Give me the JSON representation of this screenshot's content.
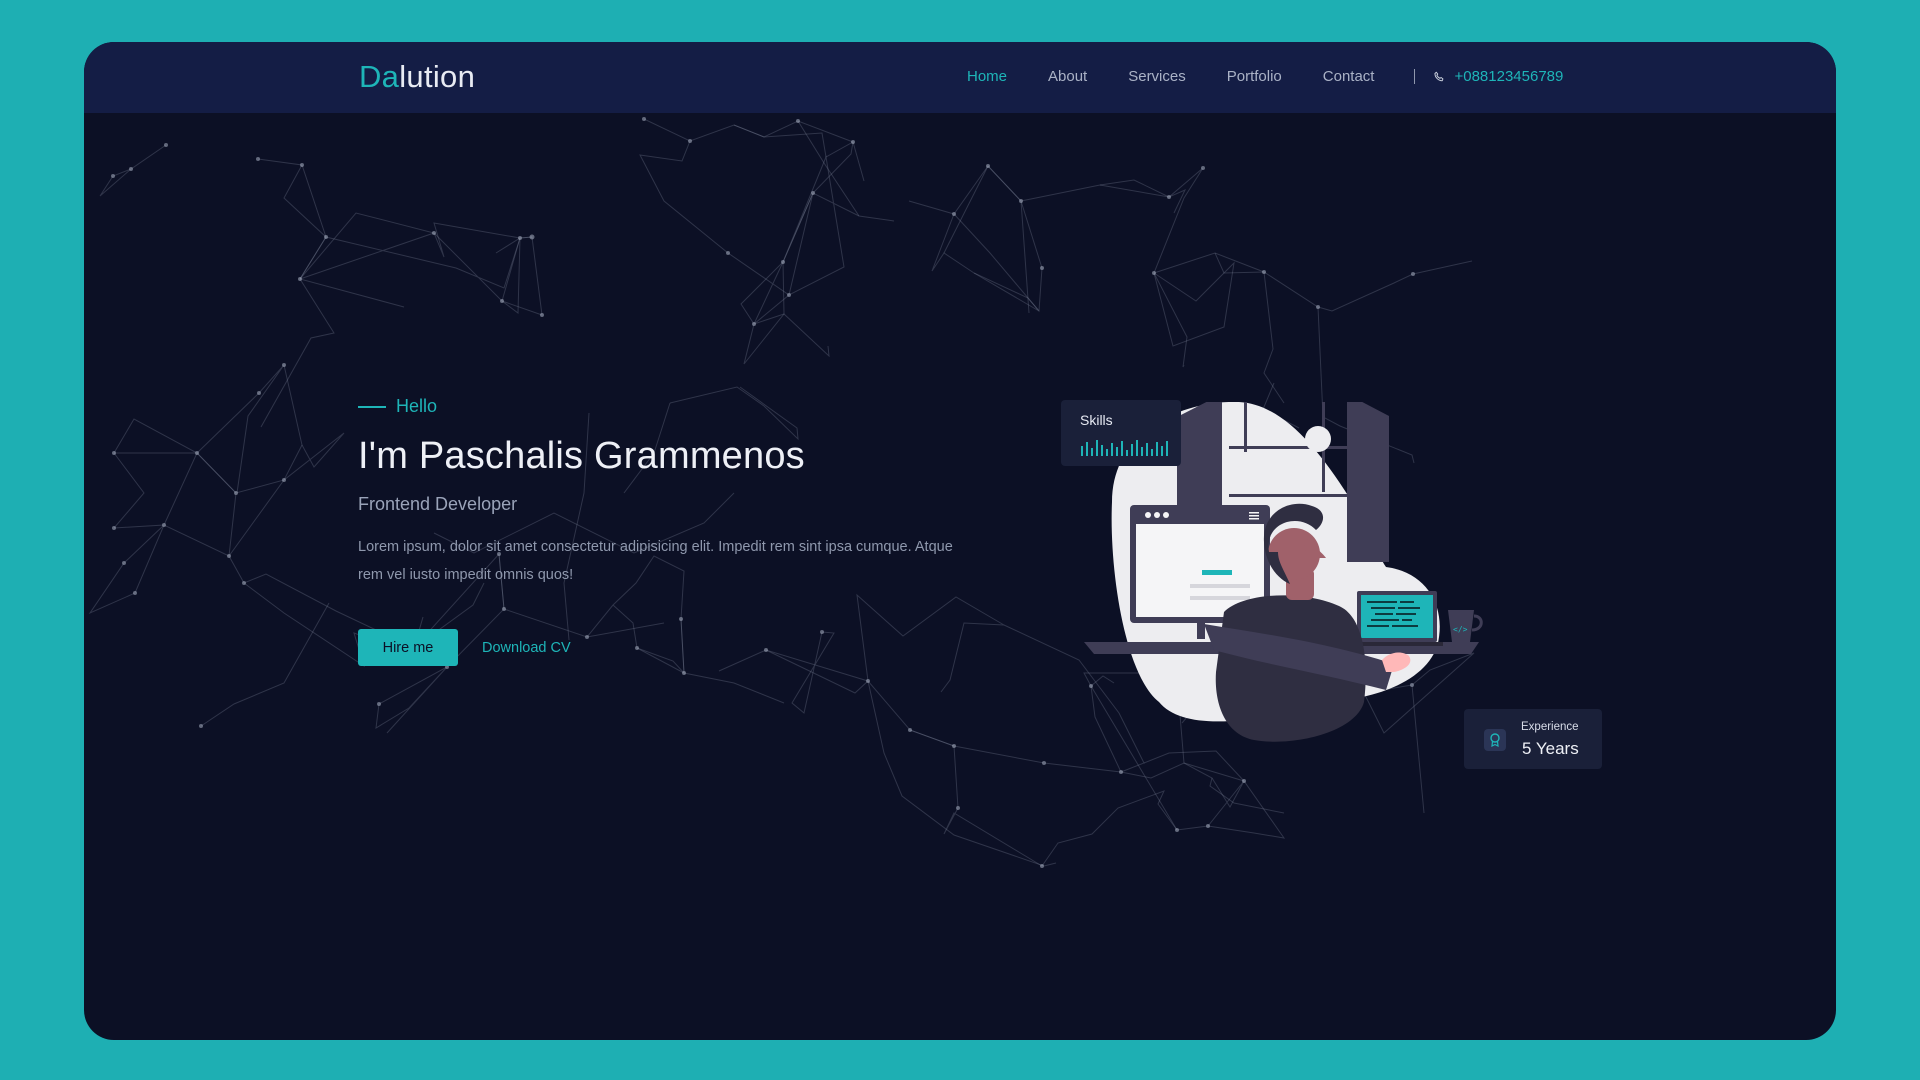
{
  "brand": {
    "prefix": "Da",
    "suffix": "lution",
    "accent_color": "#1eb5b8"
  },
  "nav": {
    "links": [
      {
        "label": "Home",
        "active": true
      },
      {
        "label": "About",
        "active": false
      },
      {
        "label": "Services",
        "active": false
      },
      {
        "label": "Portfolio",
        "active": false
      },
      {
        "label": "Contact",
        "active": false
      }
    ],
    "phone": "+088123456789",
    "phone_icon": "phone-icon"
  },
  "hero": {
    "greeting": "Hello",
    "name": "I'm Paschalis Grammenos",
    "role": "Frontend Developer",
    "description": "Lorem ipsum, dolor sit amet consectetur adipisicing elit. Impedit rem sint ipsa cumque. Atque rem vel iusto impedit omnis quos!",
    "primary_button": "Hire me",
    "secondary_button": "Download CV"
  },
  "cards": {
    "skills": {
      "title": "Skills"
    },
    "experience": {
      "label": "Experience",
      "value": "5 Years",
      "icon": "award-icon"
    }
  },
  "colors": {
    "page_background": "#1eafb3",
    "frame_background": "#0c1025",
    "navbar_background": "#141d45",
    "accent": "#1eb5b8"
  }
}
